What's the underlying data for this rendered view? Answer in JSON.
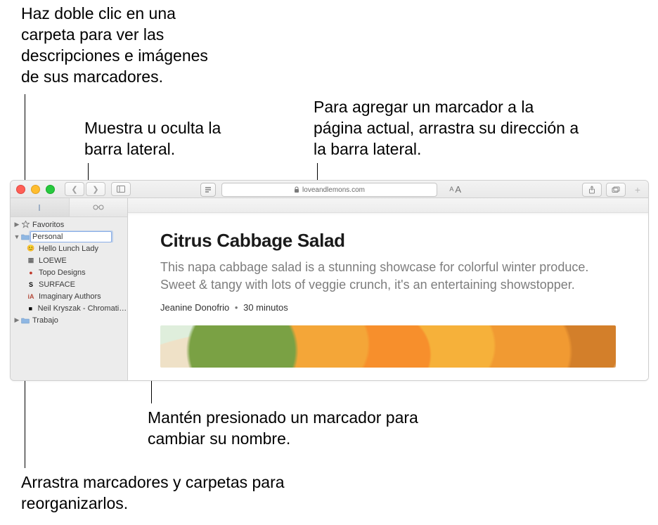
{
  "callouts": {
    "double_click": "Haz doble clic en una carpeta para ver las descripciones e imágenes de sus marcadores.",
    "show_hide_sidebar": "Muestra u oculta la barra lateral.",
    "add_bookmark": "Para agregar un marcador a la página actual, arrastra su dirección a la barra lateral.",
    "hold_rename": "Mantén presionado un marcador para cambiar su nombre.",
    "drag_reorder": "Arrastra marcadores y carpetas para reorganizarlos."
  },
  "toolbar": {
    "domain": "loveandlemons.com",
    "reader_font_label": "AA"
  },
  "sidebar": {
    "favorites_label": "Favoritos",
    "editing_folder": "Personal",
    "items": [
      {
        "label": "Hello Lunch Lady",
        "icon": "😊",
        "color": "#c9862f"
      },
      {
        "label": "LOEWE",
        "icon": "▦",
        "color": "#6b6b6b"
      },
      {
        "label": "Topo Designs",
        "icon": "●",
        "color": "#c0392b"
      },
      {
        "label": "SURFACE",
        "icon": "S",
        "color": "#000"
      },
      {
        "label": "Imaginary Authors",
        "icon": "iA",
        "color": "#b34a3a"
      },
      {
        "label": "Neil Kryszak - Chromatic E...",
        "icon": "■",
        "color": "#000"
      }
    ],
    "trabajo_label": "Trabajo"
  },
  "article": {
    "title": "Citrus Cabbage Salad",
    "summary": "This napa cabbage salad is a stunning showcase for colorful winter produce. Sweet & tangy with lots of veggie crunch, it's an entertaining showstopper.",
    "author": "Jeanine Donofrio",
    "time": "30 minutos"
  }
}
